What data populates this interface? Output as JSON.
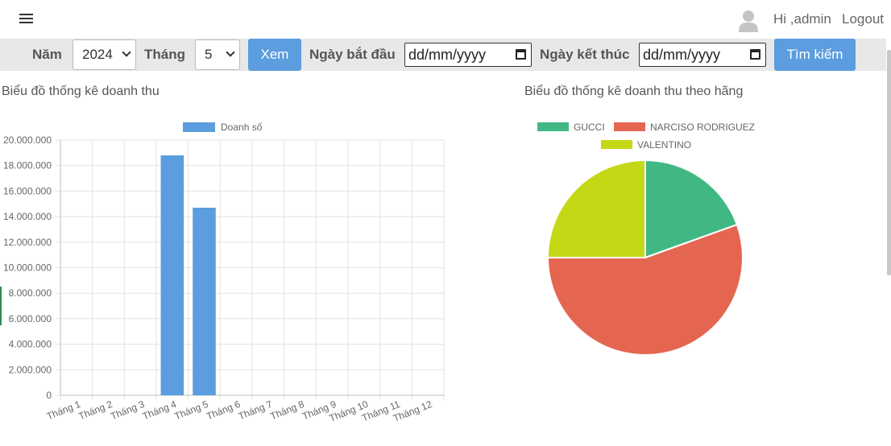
{
  "header": {
    "menu_icon": "hamburger-icon",
    "user_icon": "user-avatar-icon",
    "greeting": "Hi ,admin",
    "logout": "Logout"
  },
  "filters": {
    "year_label": "Năm",
    "year_value": "2024",
    "month_label": "Tháng",
    "month_value": "5",
    "view_button": "Xem",
    "start_label": "Ngày bắt đầu",
    "start_placeholder": "dd/mm/yyyy",
    "end_label": "Ngày kết thúc",
    "end_placeholder": "dd/mm/yyyy",
    "search_button": "Tìm kiếm"
  },
  "charts": {
    "revenue_title": "Biểu đồ thống kê doanh thu",
    "brand_title": "Biểu đồ thống kê doanh thu theo hãng"
  },
  "chart_data": [
    {
      "type": "bar",
      "categories": [
        "Tháng 1",
        "Tháng 2",
        "Tháng 3",
        "Tháng 4",
        "Tháng 5",
        "Tháng 6",
        "Tháng 7",
        "Tháng 8",
        "Tháng 9",
        "Tháng 10",
        "Tháng 11",
        "Tháng 12"
      ],
      "series": [
        {
          "name": "Doanh số",
          "color": "#5b9ddf",
          "values": [
            0,
            0,
            0,
            18800000,
            14700000,
            0,
            0,
            0,
            0,
            0,
            0,
            0
          ]
        }
      ],
      "yticks": [
        "0",
        "2.000.000",
        "4.000.000",
        "6.000.000",
        "8.000.000",
        "10.000.000",
        "12.000.000",
        "14.000.000",
        "16.000.000",
        "18.000.000",
        "20.000.000"
      ],
      "ylim": [
        0,
        20000000
      ],
      "grid": true,
      "legend": "top"
    },
    {
      "type": "pie",
      "slices": [
        {
          "label": "GUCCI",
          "value": 19.5,
          "color": "#41b883"
        },
        {
          "label": "NARCISO RODRIGUEZ",
          "value": 55.5,
          "color": "#e46651"
        },
        {
          "label": "VALENTINO",
          "value": 25,
          "color": "#c5d816"
        }
      ],
      "legend": "top"
    }
  ]
}
